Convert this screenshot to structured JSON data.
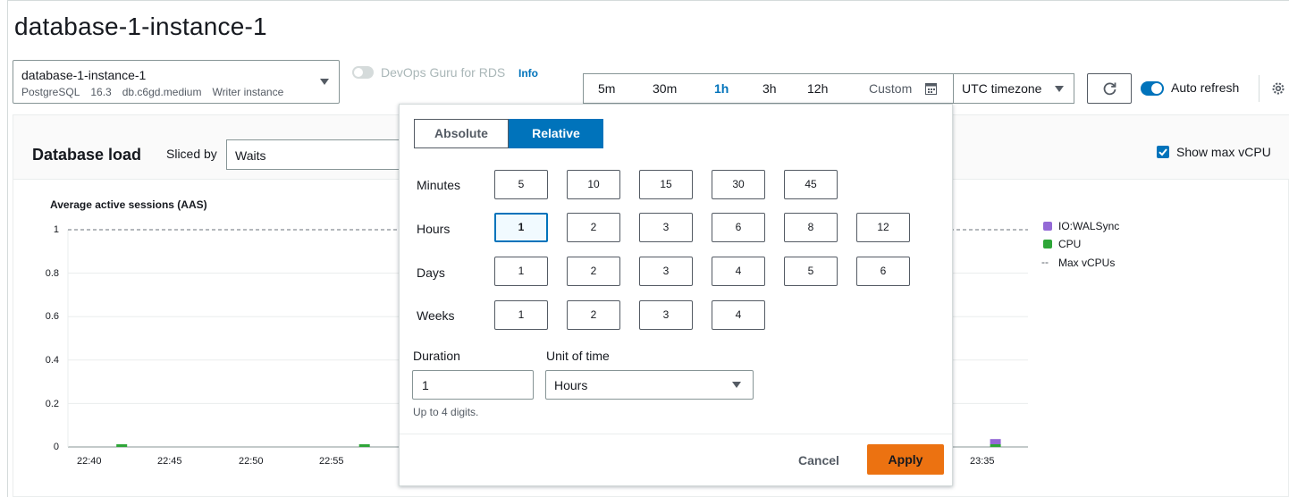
{
  "page_title": "database-1-instance-1",
  "instance_selector": {
    "name": "database-1-instance-1",
    "engine": "PostgreSQL",
    "version": "16.3",
    "class": "db.c6gd.medium",
    "role": "Writer instance"
  },
  "devops_guru": {
    "label": "DevOps Guru for RDS",
    "info": "Info",
    "enabled": false
  },
  "time_range": {
    "options": [
      "5m",
      "30m",
      "1h",
      "3h",
      "12h"
    ],
    "selected": "1h",
    "custom_label": "Custom"
  },
  "timezone": {
    "label": "UTC timezone"
  },
  "auto_refresh": {
    "label": "Auto refresh",
    "enabled": true
  },
  "db_load": {
    "title": "Database load",
    "sliced_by_label": "Sliced by",
    "sliced_by_value": "Waits",
    "show_max_vcpu_label": "Show max vCPU",
    "show_max_vcpu_checked": true
  },
  "chart_data": {
    "type": "bar",
    "title": "Average active sessions (AAS)",
    "ylim": [
      0,
      1
    ],
    "yticks": [
      "1",
      "0.8",
      "0.6",
      "0.4",
      "0.2",
      "0"
    ],
    "xticks_left": [
      "22:40",
      "22:45",
      "22:50",
      "22:55"
    ],
    "xticks_right": [
      "23:35"
    ],
    "series": [
      {
        "name": "IO:WALSync",
        "color": "#9469d6"
      },
      {
        "name": "CPU",
        "color": "#2ea638"
      }
    ],
    "max_vcpu_label": "Max vCPUs",
    "max_vcpu_value": 1,
    "visible_bars": [
      {
        "x": "22:42",
        "cpu": 0.01
      },
      {
        "x": "22:57",
        "cpu": 0.01
      },
      {
        "x": "23:36",
        "cpu": 0.01,
        "io_walsync": 0.015
      }
    ]
  },
  "range_dropdown": {
    "modes": [
      "Absolute",
      "Relative"
    ],
    "selected_mode": "Relative",
    "rows": [
      {
        "label": "Minutes",
        "options": [
          "5",
          "10",
          "15",
          "30",
          "45"
        ]
      },
      {
        "label": "Hours",
        "options": [
          "1",
          "2",
          "3",
          "6",
          "8",
          "12"
        ],
        "selected": "1"
      },
      {
        "label": "Days",
        "options": [
          "1",
          "2",
          "3",
          "4",
          "5",
          "6"
        ]
      },
      {
        "label": "Weeks",
        "options": [
          "1",
          "2",
          "3",
          "4"
        ]
      }
    ],
    "duration_label": "Duration",
    "duration_value": "1",
    "duration_hint": "Up to 4 digits.",
    "unit_label": "Unit of time",
    "unit_value": "Hours",
    "cancel_label": "Cancel",
    "apply_label": "Apply"
  },
  "colors": {
    "accent": "#0073bb",
    "apply": "#ec7211"
  }
}
